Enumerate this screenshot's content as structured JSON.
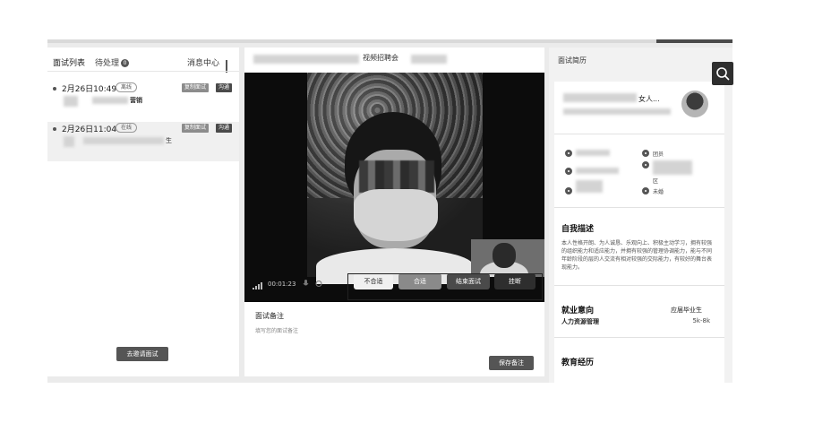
{
  "left_panel": {
    "tab_interview_list": "面试列表",
    "tab_pending": "待处理",
    "pending_badge": "0",
    "message_center": "消息中心",
    "items": [
      {
        "time": "2月26日10:49",
        "status": "离线",
        "btn_copy": "复制面试",
        "btn_chat": "沟通",
        "subtitle": "营销"
      },
      {
        "time": "2月26日11:04",
        "status": "在线",
        "btn_copy": "复制面试",
        "btn_chat": "沟通",
        "subtitle": "生"
      }
    ],
    "invite_button": "去邀请面试"
  },
  "middle_panel": {
    "title": "视频招聘会",
    "timer": "00:01:23",
    "buttons": {
      "reject": "不合适",
      "pass": "合适",
      "end": "结束面试",
      "hangup": "挂断"
    },
    "memo_title": "面试备注",
    "memo_placeholder": "填写您的面试备注",
    "save_button": "保存备注"
  },
  "right_panel": {
    "title": "面试简历",
    "name_suffix": "女人...",
    "info_1": "团员",
    "info_2": "区",
    "info_3": "未婚",
    "self_desc_title": "自我描述",
    "self_desc": "本人性格开朗、为人诚恳、乐观向上、积极主动学习，拥有较强的组织能力和适应能力，并拥有较强的管理协调能力，能与不同年龄阶段的层的人交流有相对较强的交际能力，有较好的舞台表现能力。",
    "job_intent_title": "就业意向",
    "graduate_label": "应届毕业生",
    "job_role": "人力资源管理",
    "salary": "5k-8k",
    "education_title": "教育经历"
  }
}
